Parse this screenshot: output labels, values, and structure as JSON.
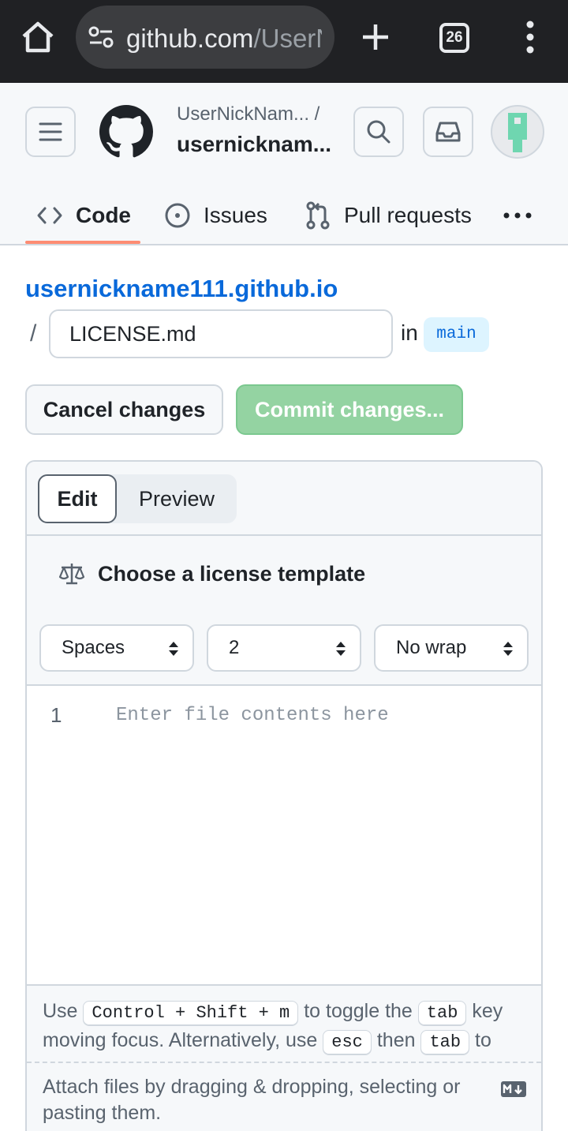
{
  "browser": {
    "url_host": "github.com",
    "url_path": "/UserN",
    "tab_count": "26"
  },
  "header": {
    "owner": "UserNickNam... /",
    "repo": "usernicknam..."
  },
  "nav": {
    "code": "Code",
    "issues": "Issues",
    "pull_requests": "Pull requests"
  },
  "editor": {
    "repo_link": "usernickname111.github.io",
    "path_separator": "/",
    "filename": "LICENSE.md",
    "in_label": "in",
    "branch": "main",
    "cancel_label": "Cancel changes",
    "commit_label": "Commit changes...",
    "tab_edit": "Edit",
    "tab_preview": "Preview",
    "license_template": "Choose a license template",
    "indent_mode": "Spaces",
    "indent_size": "2",
    "wrap_mode": "No wrap",
    "line_number": "1",
    "placeholder": "Enter file contents here"
  },
  "help": {
    "use": "Use",
    "shortcut": "Control + Shift + m",
    "to_toggle": "to toggle the",
    "tab_key": "tab",
    "key_moving": "key moving focus. Alternatively, use",
    "esc_key": "esc",
    "then": "then",
    "tab_key2": "tab",
    "to_move": "to move to the next interactive element on the page."
  },
  "attach": {
    "text": "Attach files by dragging & dropping, selecting or pasting them."
  },
  "colors": {
    "link": "#0969da",
    "commit_disabled": "#94d3a2",
    "nav_underline": "#fd8c73",
    "browser_bar": "#202124"
  }
}
